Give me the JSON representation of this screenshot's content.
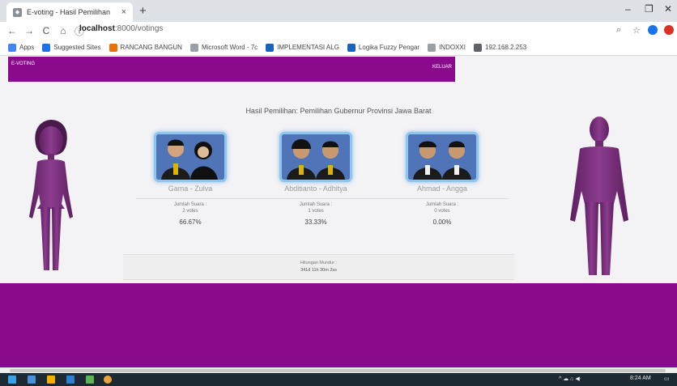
{
  "browser": {
    "tab_title": "E-voting - Hasil Pemilihan",
    "tab_close": "×",
    "new_tab": "+",
    "window": {
      "minimize": "–",
      "maximize": "❐",
      "close": "✕"
    },
    "nav": {
      "back": "←",
      "forward": "→",
      "reload": "C",
      "home": "⌂",
      "info": "ⓘ"
    },
    "url_host": "localhost",
    "url_path": ":8000/votings",
    "bookmarks": [
      {
        "label": "Apps",
        "color": "#4285f4"
      },
      {
        "label": "Suggested Sites",
        "color": "#1a73e8"
      },
      {
        "label": "RANCANG BANGUN",
        "color": "#e8710a"
      },
      {
        "label": "Microsoft Word - 7c",
        "color": "#9aa0a6"
      },
      {
        "label": "IMPLEMENTASI ALG",
        "color": "#1565c0"
      },
      {
        "label": "Logika Fuzzy Pengar",
        "color": "#1565c0"
      },
      {
        "label": "INDOXXI",
        "color": "#9aa0a6"
      },
      {
        "label": "192.168.2.253",
        "color": "#5f6368"
      }
    ]
  },
  "app": {
    "brand": "E-VOTING",
    "logout": "KELUAR",
    "title": "Hasil Pemilihan: Pemilihan Gubernur Provinsi Jawa Barat",
    "candidates": [
      {
        "name": "Gama - Zulva",
        "votes_label": "Jumlah Suara :",
        "votes": "2 votes",
        "percent": "66.67%"
      },
      {
        "name": "Abditianto - Adhitya",
        "votes_label": "Jumlah Suara :",
        "votes": "1 votes",
        "percent": "33.33%"
      },
      {
        "name": "Ahmad - Angga",
        "votes_label": "Jumlah Suara :",
        "votes": "0 votes",
        "percent": "0.00%"
      }
    ],
    "countdown_label": "Hitungan Mundur :",
    "countdown_value": "341d 11h 30m 2ss"
  },
  "taskbar": {
    "tray_text": "^ ☁ ⌂ ◀ᐧ",
    "time": "8:24 AM"
  },
  "colors": {
    "brand_purple": "#8a0a8c",
    "figure_purple": "#7a2f7c",
    "photo_border": "#8fc6ef"
  }
}
